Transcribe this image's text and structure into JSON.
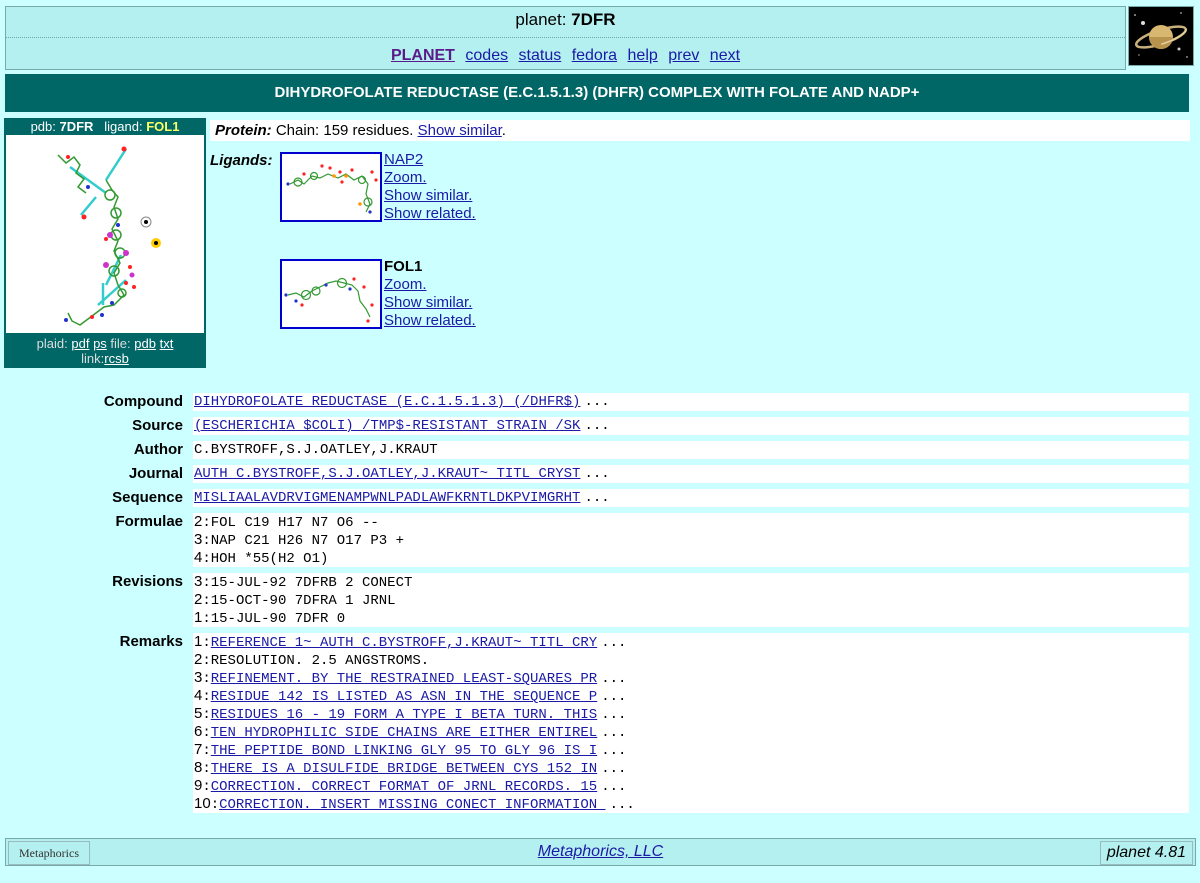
{
  "header": {
    "title_prefix": "planet: ",
    "title_id": "7DFR",
    "nav": [
      "PLANET",
      "codes",
      "status",
      "fedora",
      "help",
      "prev",
      "next"
    ]
  },
  "title_bar": "DIHYDROFOLATE REDUCTASE (E.C.1.5.1.3) (DHFR) COMPLEX WITH FOLATE AND NADP+",
  "left_panel": {
    "pdb_label": "pdb: ",
    "pdb_id": "7DFR",
    "ligand_label": "ligand: ",
    "ligand_id": "FOL1",
    "plaid_label": "plaid: ",
    "pdf": "pdf",
    "ps": "ps",
    "file_label": " file: ",
    "pdb": "pdb",
    "txt": "txt",
    "link_label": "link:",
    "rcsb": "rcsb"
  },
  "protein": {
    "label": "Protein:",
    "text": " Chain: 159 residues. ",
    "link": "Show similar",
    "end": "."
  },
  "ligands": {
    "label": "Ligands:",
    "items": [
      {
        "name": "NAP2",
        "zoom": "Zoom.",
        "similar": "Show similar.",
        "related": "Show related."
      },
      {
        "name": "FOL1",
        "zoom": "Zoom.",
        "similar": "Show similar.",
        "related": "Show related."
      }
    ]
  },
  "info": {
    "compound": {
      "label": "Compound",
      "value": "DIHYDROFOLATE REDUCTASE (E.C.1.5.1.3) (/DHFR$)",
      "more": "..."
    },
    "source": {
      "label": "Source",
      "value": "(ESCHERICHIA $COLI) /TMP$-RESISTANT STRAIN /SK",
      "more": "..."
    },
    "author": {
      "label": "Author",
      "value": "C.BYSTROFF,S.J.OATLEY,J.KRAUT"
    },
    "journal": {
      "label": "Journal",
      "value": "AUTH C.BYSTROFF,S.J.OATLEY,J.KRAUT~ TITL CRYST",
      "more": "..."
    },
    "sequence": {
      "label": "Sequence",
      "value": "MISLIAALAVDRVIGMENAMPWNLPADLAWFKRNTLDKPVIMGRHT",
      "more": "..."
    },
    "formulae": {
      "label": "Formulae",
      "lines": [
        {
          "n": "2",
          "text": "FOL C19 H17 N7 O6 --"
        },
        {
          "n": "3",
          "text": "NAP C21 H26 N7 O17 P3 +"
        },
        {
          "n": "4",
          "text": "HOH *55(H2 O1)"
        }
      ]
    },
    "revisions": {
      "label": "Revisions",
      "lines": [
        {
          "n": "3",
          "text": "15-JUL-92 7DFRB 2 CONECT"
        },
        {
          "n": "2",
          "text": "15-OCT-90 7DFRA 1 JRNL"
        },
        {
          "n": "1",
          "text": "15-JUL-90 7DFR 0"
        }
      ]
    },
    "remarks": {
      "label": "Remarks",
      "more": "...",
      "lines": [
        {
          "n": "1",
          "text": "REFERENCE 1~ AUTH C.BYSTROFF,J.KRAUT~ TITL CRY",
          "link": true
        },
        {
          "n": "2",
          "text": "RESOLUTION. 2.5 ANGSTROMS.",
          "link": false
        },
        {
          "n": "3",
          "text": "REFINEMENT. BY THE RESTRAINED LEAST-SQUARES PR",
          "link": true
        },
        {
          "n": "4",
          "text": "RESIDUE 142 IS LISTED AS ASN IN THE SEQUENCE P",
          "link": true
        },
        {
          "n": "5",
          "text": "RESIDUES 16 - 19 FORM A TYPE I BETA TURN. THIS",
          "link": true
        },
        {
          "n": "6",
          "text": "TEN HYDROPHILIC SIDE CHAINS ARE EITHER ENTIREL",
          "link": true
        },
        {
          "n": "7",
          "text": "THE PEPTIDE BOND LINKING GLY 95 TO GLY 96 IS I",
          "link": true
        },
        {
          "n": "8",
          "text": "THERE IS A DISULFIDE BRIDGE BETWEEN CYS 152 IN",
          "link": true
        },
        {
          "n": "9",
          "text": "CORRECTION. CORRECT FORMAT OF JRNL RECORDS. 15",
          "link": true
        },
        {
          "n": "10",
          "text": "CORRECTION. INSERT MISSING CONECT INFORMATION ",
          "link": true
        }
      ]
    }
  },
  "footer": {
    "logo": "Metaphorics",
    "center": "Metaphorics, LLC",
    "right": "planet 4.81"
  }
}
